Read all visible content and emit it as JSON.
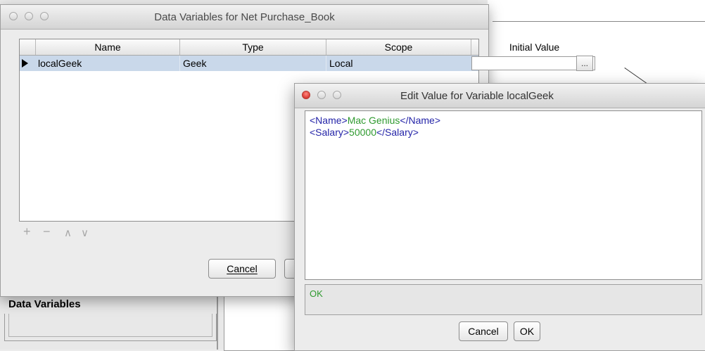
{
  "main_dialog": {
    "title": "Data Variables for Net Purchase_Book",
    "columns": [
      "Name",
      "Type",
      "Scope",
      "Initial Value"
    ],
    "rows": [
      {
        "name": "localGeek",
        "type": "Geek",
        "scope": "Local",
        "initial_value": ""
      }
    ],
    "ellipsis_label": "...",
    "toolbar": {
      "add": "+",
      "remove": "−",
      "up": "∧",
      "down": "∨"
    },
    "cancel_label": "Cancel"
  },
  "background": {
    "data_variables_label": "Data Variables"
  },
  "edit_dialog": {
    "title": "Edit Value for Variable localGeek",
    "lines": [
      {
        "open_tag": "<Name>",
        "value": "Mac Genius",
        "close_tag": "</Name>"
      },
      {
        "open_tag": "<Salary>",
        "value": "50000",
        "close_tag": "</Salary>"
      }
    ],
    "status": "OK",
    "cancel_label": "Cancel",
    "ok_label": "OK"
  },
  "colors": {
    "tag": "#2424a8",
    "value": "#2f9a2f",
    "selection": "#c9d8ea"
  }
}
